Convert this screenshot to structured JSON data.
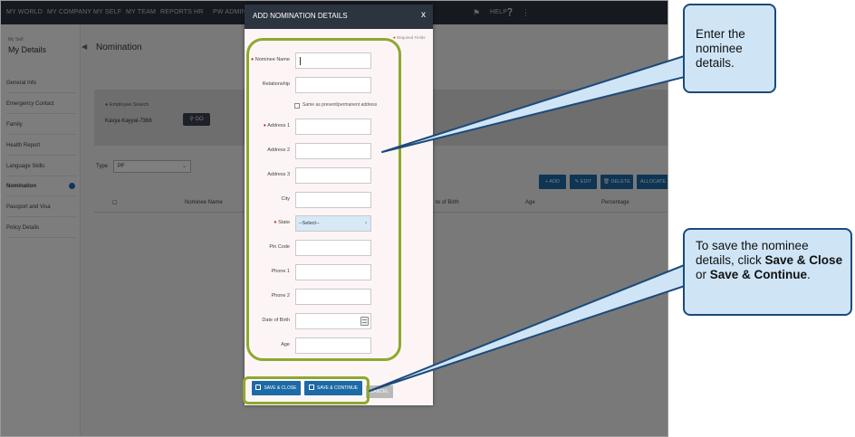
{
  "topnav": {
    "items": [
      "MY WORLD",
      "MY COMPANY",
      "MY SELF",
      "MY TEAM",
      "REPORTS",
      "HR",
      "PW ADMIN"
    ],
    "help": "HELP"
  },
  "sidebar": {
    "crumb": "My Self",
    "title": "My Details",
    "items": [
      "General Info",
      "Emergency Contact",
      "Family",
      "Health Report",
      "Language Skills",
      "Nomination",
      "Passport and Visa",
      "Policy Details"
    ]
  },
  "main": {
    "title": "Nomination",
    "employee_search_label": "Employee Search",
    "employee_search_value": "Kavya Kayyal-7366",
    "go_button": "GO",
    "type_label": "Type",
    "type_value": "PF",
    "actions": [
      "ADD",
      "EDIT",
      "DELETE",
      "ALLOCATE"
    ],
    "columns": [
      "Nominee Name",
      "te of Birth",
      "Age",
      "Percentage"
    ]
  },
  "modal": {
    "title": "ADD NOMINATION DETAILS",
    "close": "x",
    "required_note": "Required Fields",
    "fields": {
      "nominee_name": "Nominee Name",
      "relationship": "Relationship",
      "same_as_address": "Same as present/permanent address",
      "address1": "Address 1",
      "address2": "Address 2",
      "address3": "Address 3",
      "city": "City",
      "state": "State",
      "state_value": "--Select--",
      "pin_code": "Pin Code",
      "phone1": "Phone 1",
      "phone2": "Phone 2",
      "dob": "Date of Birth",
      "age": "Age"
    },
    "buttons": {
      "save_close": "SAVE & CLOSE",
      "save_continue": "SAVE & CONTINUE",
      "cancel": "CANCEL"
    }
  },
  "callouts": {
    "c1": "Enter the nominee details.",
    "c2_pre": "To save the nominee details, click ",
    "c2_b1": "Save & Close",
    "c2_mid": " or ",
    "c2_b2": "Save & Continue",
    "c2_post": "."
  },
  "colors": {
    "highlight": "#8ea82f",
    "callout_fill": "#cfe5f6",
    "callout_border": "#1c4a7a",
    "primary_button": "#1c6aa6",
    "nav_bg": "#2c3440"
  }
}
